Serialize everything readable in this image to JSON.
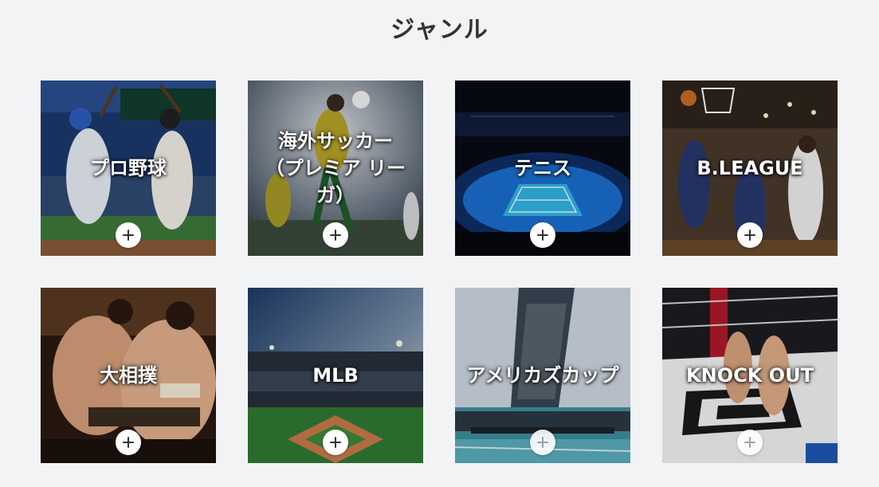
{
  "section": {
    "title": "ジャンル"
  },
  "genres": [
    {
      "label": "プロ野球",
      "icon": "plus-icon"
    },
    {
      "label": "海外サッカー\n（プレミア リーガ）",
      "icon": "plus-icon"
    },
    {
      "label": "テニス",
      "icon": "plus-icon"
    },
    {
      "label": "B.LEAGUE",
      "icon": "plus-icon"
    },
    {
      "label": "大相撲",
      "icon": "plus-icon"
    },
    {
      "label": "MLB",
      "icon": "plus-icon"
    },
    {
      "label": "アメリカズカップ",
      "icon": "plus-icon"
    },
    {
      "label": "KNOCK OUT",
      "icon": "plus-icon"
    }
  ],
  "colors": {
    "background": "#f2f3f5",
    "title": "#333333",
    "button": "#ffffff"
  }
}
